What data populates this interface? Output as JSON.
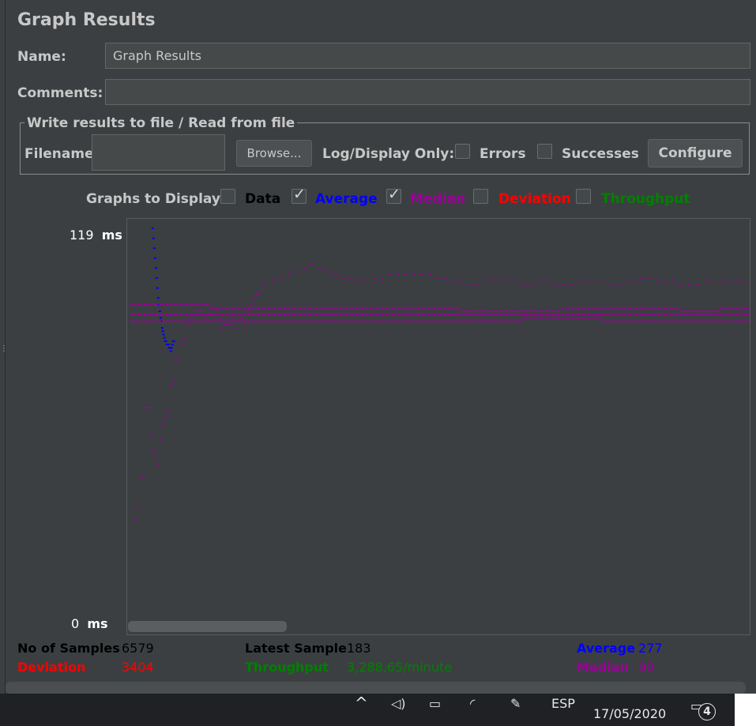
{
  "panel": {
    "title": "Graph Results",
    "name_label": "Name:",
    "name_value": "Graph Results",
    "comments_label": "Comments:",
    "comments_value": ""
  },
  "file_section": {
    "legend": "Write results to file / Read from file",
    "filename_label": "Filename",
    "filename_value": "",
    "browse_label": "Browse...",
    "log_display_label": "Log/Display Only:",
    "errors_label": "Errors",
    "errors_checked": false,
    "successes_label": "Successes",
    "successes_checked": false,
    "configure_label": "Configure"
  },
  "graphs_to_display": {
    "label": "Graphs to Display",
    "options": [
      {
        "label": "Data",
        "checked": false,
        "color": "#000000"
      },
      {
        "label": "Average",
        "checked": true,
        "color": "#0000ff"
      },
      {
        "label": "Median",
        "checked": true,
        "color": "#9b009b"
      },
      {
        "label": "Deviation",
        "checked": false,
        "color": "#ff0000"
      },
      {
        "label": "Throughput",
        "checked": false,
        "color": "#008000"
      }
    ]
  },
  "chart_data": {
    "type": "scatter",
    "ylim": [
      0,
      119
    ],
    "y_top_label": "119",
    "y_bottom_label": "0",
    "y_unit": "ms",
    "series": [
      {
        "name": "Average",
        "color": "#0000ff",
        "x": [
          27,
          28,
          29,
          30,
          31,
          32,
          33,
          34,
          35,
          36,
          37,
          38,
          39,
          40,
          41,
          42,
          43,
          44,
          45,
          46,
          47,
          48,
          49,
          50,
          51,
          52,
          53,
          54
        ],
        "y": [
          119,
          116,
          113,
          110,
          107,
          104,
          101,
          98,
          96,
          94,
          92,
          91,
          89,
          88,
          87,
          86,
          85,
          85,
          84,
          84,
          84,
          83,
          83,
          82,
          83,
          84,
          85,
          85
        ]
      },
      {
        "name": "Median",
        "color": "#9b009b",
        "x": [
          5,
          8,
          12,
          15,
          18,
          22,
          25,
          28,
          31,
          34,
          37,
          40,
          43,
          46,
          50,
          53,
          56,
          60,
          64,
          68,
          72,
          76,
          80,
          84,
          88,
          92,
          96,
          100,
          104,
          108,
          112,
          116,
          120,
          124,
          128,
          132,
          136,
          140,
          144,
          148,
          152,
          156,
          160,
          164,
          170,
          180,
          190,
          200,
          210,
          220,
          230,
          240,
          250,
          260,
          270,
          280,
          290,
          300,
          310,
          320,
          330,
          340,
          350,
          360,
          370,
          380,
          390,
          400,
          410,
          420,
          430,
          440,
          450,
          460,
          470,
          480,
          490,
          500,
          510,
          520,
          530,
          540,
          550,
          560,
          570,
          580,
          590,
          600,
          610,
          620,
          630,
          640,
          650,
          660,
          670,
          680,
          690,
          700,
          710,
          720,
          730,
          740,
          750,
          760,
          770,
          780
        ],
        "y": [
          31,
          35,
          44,
          44,
          65,
          65,
          57,
          52,
          50,
          48,
          55,
          60,
          62,
          64,
          72,
          73,
          80,
          80,
          84,
          86,
          90,
          92,
          93,
          94,
          94,
          92,
          93,
          95,
          95,
          94,
          92,
          89,
          90,
          90,
          92,
          89,
          91,
          92,
          90,
          94,
          96,
          98,
          99,
          100,
          102,
          103,
          104,
          105,
          106,
          107,
          108,
          107,
          106,
          105,
          104,
          104,
          103,
          103,
          104,
          104,
          105,
          105,
          105,
          105,
          105,
          105,
          104,
          104,
          103,
          103,
          102,
          102,
          103,
          104,
          104,
          103,
          103,
          102,
          102,
          103,
          103,
          102,
          102,
          102,
          103,
          103,
          103,
          103,
          102,
          102,
          103,
          103,
          104,
          104,
          103,
          103,
          103,
          102,
          102,
          102,
          103,
          103,
          103,
          103,
          103,
          103
        ]
      },
      {
        "name": "Median band upper",
        "color": "#9b009b",
        "x": [
          0,
          50,
          100,
          150,
          200,
          250,
          300,
          350,
          400,
          420,
          450,
          500,
          550,
          570,
          600,
          650,
          700,
          750,
          785
        ],
        "y": [
          96,
          96,
          95,
          95,
          95,
          95,
          95,
          95,
          95,
          94,
          94,
          94,
          95,
          95,
          95,
          95,
          94,
          95,
          95
        ]
      },
      {
        "name": "Median band lower",
        "color": "#9b009b",
        "x": [
          0,
          50,
          100,
          150,
          200,
          250,
          300,
          350,
          400,
          420,
          450,
          500,
          550,
          570,
          600,
          650,
          700,
          750,
          785
        ],
        "y": [
          91,
          91,
          91,
          91,
          91,
          91,
          91,
          91,
          91,
          91,
          91,
          92,
          92,
          92,
          91,
          91,
          91,
          91,
          91
        ]
      },
      {
        "name": "Median band middle",
        "color": "#9b009b",
        "x": [
          0,
          50,
          100,
          150,
          200,
          250,
          300,
          350,
          400,
          420,
          450,
          500,
          550,
          570,
          600,
          650,
          700,
          750,
          785
        ],
        "y": [
          93,
          93,
          93,
          93,
          93,
          93,
          93,
          93,
          93,
          93,
          93,
          93,
          93,
          93,
          93,
          93,
          93,
          93,
          93
        ]
      }
    ],
    "legend": "none",
    "grid": false
  },
  "stats": {
    "samples_label": "No of Samples",
    "samples_value": "6579",
    "latest_label": "Latest Sample",
    "latest_value": "183",
    "average_label": "Average",
    "average_value": "277",
    "deviation_label": "Deviation",
    "deviation_value": "3404",
    "throughput_label": "Throughput",
    "throughput_value": "3,288.65/minute",
    "median_label": "Median",
    "median_value": "90"
  },
  "taskbar": {
    "language": "ESP",
    "date": "17/05/2020",
    "notifications": "4"
  }
}
